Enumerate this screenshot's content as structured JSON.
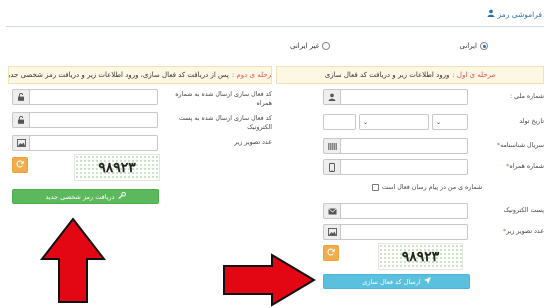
{
  "header": {
    "title": "فراموشی رمز"
  },
  "nationality": {
    "options": [
      "ایرانی",
      "غیر ایرانی"
    ],
    "selected": "ایرانی"
  },
  "right_panel": {
    "step_prefix": "مرحله ی اول :",
    "step_text": "ورود اطلاعات زیر و دریافت کد فعال سازی",
    "national_code_label": "شماره ملی :",
    "birth_date_label": "تاریخ تولد",
    "serial_label": "سریال شناسنامه",
    "mobile_label": "شماره همراه",
    "notify_checkbox_label": "شماره ی من در پیام رسان فعال است",
    "email_label": "پست الکترونیک",
    "captcha_label": "عدد تصویر زیر",
    "captcha_value": "۹۸۹۲۳",
    "submit_label": "ارسال کد فعال سازی",
    "required_mark": "*"
  },
  "left_panel": {
    "step_prefix": "مرحله ی دوم :",
    "step_text": "پس از دریافت کد فعال سازی، ورود اطلاعات زیر و دریافت رمز شخصی جدید",
    "sms_code_label": "کد فعال سازی ارسال شده به شماره همراه",
    "email_code_label": "کد فعال سازی ارسال شده به پست الکترونیک",
    "captcha_label": "عدد تصویر زیر",
    "captcha_value": "۹۸۹۲۳",
    "submit_label": "دریافت رمز شخصی جدید"
  },
  "colors": {
    "arrow": "#e30613",
    "green_button": "#5cb85c",
    "blue_button": "#5bc0de",
    "refresh_button": "#f0ad4e",
    "step_red": "#d9534f"
  }
}
